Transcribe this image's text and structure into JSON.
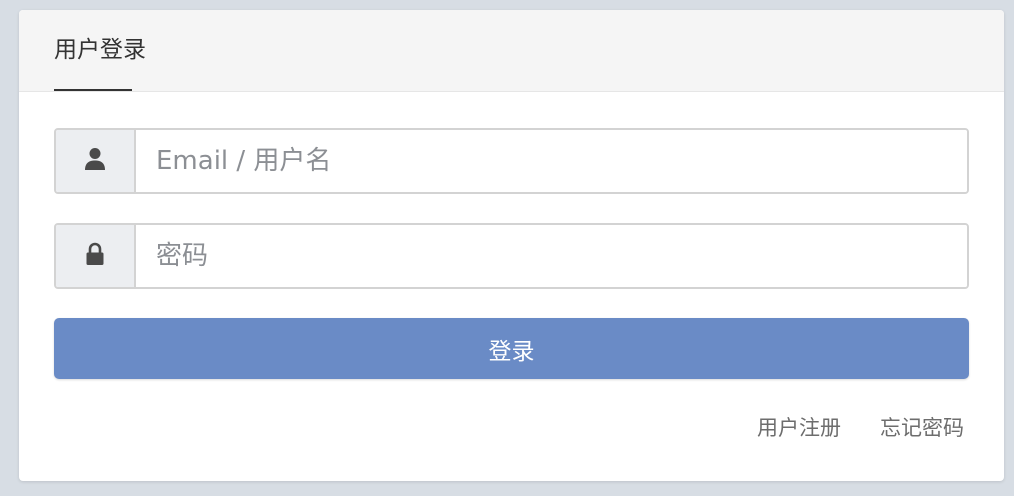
{
  "header": {
    "tab_label": "用户登录"
  },
  "form": {
    "username_placeholder": "Email / 用户名",
    "username_icon": "user-icon",
    "password_placeholder": "密码",
    "password_icon": "lock-icon",
    "login_label": "登录"
  },
  "links": {
    "register": "用户注册",
    "forgot_password": "忘记密码"
  },
  "colors": {
    "primary": "#6a8bc6",
    "background": "#d7dde4"
  }
}
